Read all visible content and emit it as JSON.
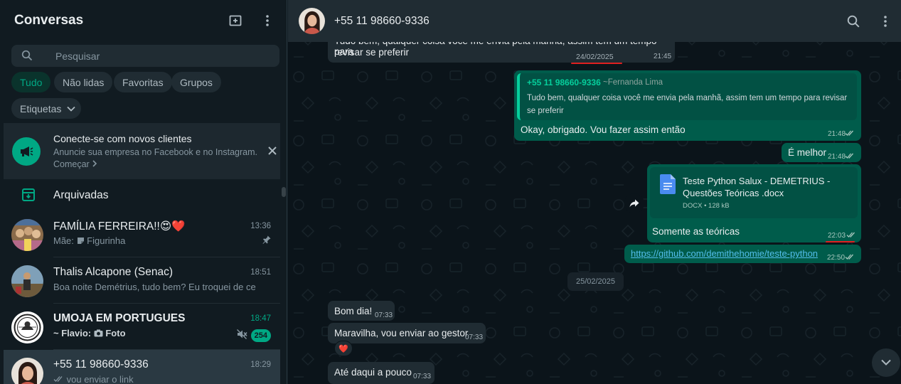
{
  "sidebar": {
    "title": "Conversas",
    "search": {
      "placeholder": "Pesquisar"
    },
    "filters": [
      {
        "label": "Tudo",
        "active": true
      },
      {
        "label": "Não lidas",
        "active": false
      },
      {
        "label": "Favoritas",
        "active": false
      },
      {
        "label": "Grupos",
        "active": false
      },
      {
        "label": "Etiquetas",
        "active": false
      }
    ],
    "promo": {
      "title": "Conecte-se com novos clientes",
      "subtitle": "Anuncie sua empresa no Facebook e no Instagram.",
      "cta": "Começar"
    },
    "archived_label": "Arquivadas",
    "chats": [
      {
        "name": "FAMÍLIA FERREIRA!!😍❤️",
        "time": "13:36",
        "sender": "Mãe:",
        "preview": "Figurinha",
        "pinned": true
      },
      {
        "name": "Thalis Alcapone (Senac)",
        "time": "18:51",
        "preview": "Boa noite Demétrius, tudo bem?  Eu troquei de celul..."
      },
      {
        "name": "UMOJA EM PORTUGUES",
        "time": "18:47",
        "sender": "~ Flavio:",
        "preview": "Foto",
        "unread": "254",
        "muted": true
      },
      {
        "name": "+55 11 98660-9336",
        "time": "18:29",
        "preview": "vou enviar o link",
        "selected": true
      }
    ]
  },
  "conversation": {
    "title": "+55 11 98660-9336",
    "messages": {
      "m1_text_line1": "Tudo bem, qualquer coisa você me envia pela manhã, assim tem um tempo para",
      "m1_text_line2": "revisar se preferir",
      "m1_date": "24/02/2025",
      "m1_time": "21:45",
      "m2_quote_name": "+55 11 98660-9336",
      "m2_quote_alias": "~Fernanda Lima",
      "m2_quote_text": "Tudo bem, qualquer coisa você me envia pela manhã, assim tem um tempo para revisar se preferir",
      "m2_text": "Okay, obrigado. Vou fazer assim então",
      "m2_time": "21:48",
      "m3_text": "É melhor",
      "m3_time": "21:48",
      "m4_doc_name": "Teste Python Salux - DEMETRIUS - Questões Teóricas .docx",
      "m4_doc_meta": "DOCX • 128 kB",
      "m4_text": "Somente as teóricas",
      "m4_time": "22:03",
      "m5_link": "https://github.com/demithehomie/teste-python",
      "m5_time": "22:50",
      "date_divider": "25/02/2025",
      "m6_text": "Bom dia!",
      "m6_time": "07:33",
      "m7_text": "Maravilha, vou enviar ao gestor",
      "m7_time": "07:33",
      "m7_reaction": "❤️",
      "m8_text": "Até daqui a pouco",
      "m8_time": "07:33"
    }
  },
  "colors": {
    "accent": "#00a884",
    "outgoing_bubble": "#005c4b",
    "incoming_bubble": "#202c33",
    "annotation": "#e02020"
  }
}
